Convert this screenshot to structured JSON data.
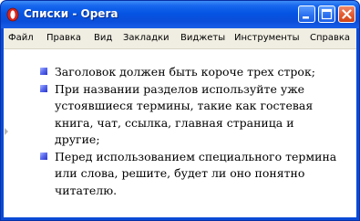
{
  "window": {
    "title": "Списки - Opera",
    "app_icon": "opera-icon",
    "controls": {
      "minimize": "minimize-icon",
      "maximize": "maximize-icon",
      "close": "close-icon"
    }
  },
  "menubar": {
    "items": [
      "Файл",
      "Правка",
      "Вид",
      "Закладки",
      "Виджеты",
      "Инструменты",
      "Справка"
    ]
  },
  "content": {
    "list": [
      "Заголовок должен быть короче трех строк;",
      "При названии разделов используйте уже устоявшиеся термины, такие как гостевая книга, чат, ссылка, главная страница и другие;",
      "Перед использованием специального термина или слова, решите, будет ли оно понятно читателю."
    ]
  },
  "colors": {
    "titlebar": "#0554e3",
    "menubar": "#f0eee2",
    "bullet": "#3b49dc",
    "close_button": "#e35a2f"
  }
}
